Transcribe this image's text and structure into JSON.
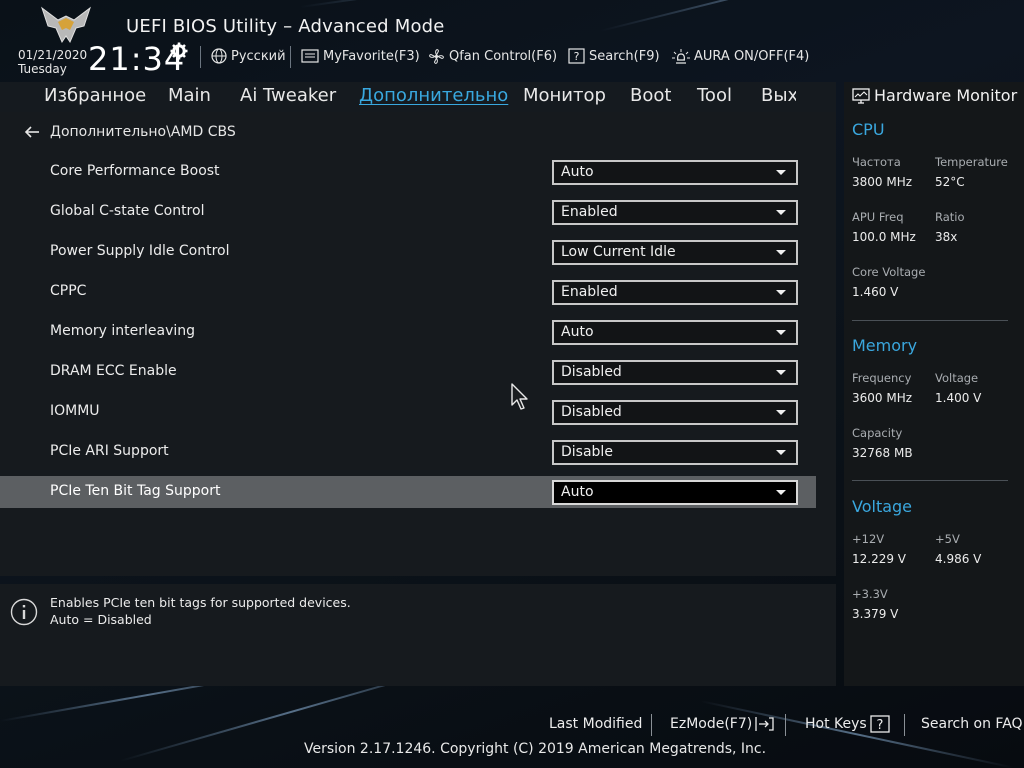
{
  "header": {
    "app_title": "UEFI BIOS Utility – Advanced Mode",
    "date": "01/21/2020",
    "day": "Tuesday",
    "time": "21:34",
    "toolbar": [
      {
        "label": "Русский",
        "icon": "globe-icon"
      },
      {
        "label": "MyFavorite(F3)",
        "icon": "favorite-icon"
      },
      {
        "label": "Qfan Control(F6)",
        "icon": "fan-icon"
      },
      {
        "label": "Search(F9)",
        "icon": "search-icon"
      },
      {
        "label": "AURA ON/OFF(F4)",
        "icon": "aura-icon"
      }
    ]
  },
  "nav": {
    "tabs": [
      {
        "label": "Избранное",
        "active": false
      },
      {
        "label": "Main",
        "active": false
      },
      {
        "label": "Ai Tweaker",
        "active": false
      },
      {
        "label": "Дополнительно",
        "active": true
      },
      {
        "label": "Монитор",
        "active": false
      },
      {
        "label": "Boot",
        "active": false
      },
      {
        "label": "Tool",
        "active": false
      },
      {
        "label": "Выход",
        "active": false
      }
    ]
  },
  "main": {
    "breadcrumb": "Дополнительно\\AMD CBS",
    "settings": [
      {
        "label": "Core Performance Boost",
        "value": "Auto"
      },
      {
        "label": "Global C-state Control",
        "value": "Enabled"
      },
      {
        "label": "Power Supply Idle Control",
        "value": "Low Current Idle"
      },
      {
        "label": "CPPC",
        "value": "Enabled"
      },
      {
        "label": "Memory interleaving",
        "value": "Auto"
      },
      {
        "label": "DRAM ECC Enable",
        "value": "Disabled"
      },
      {
        "label": "IOMMU",
        "value": "Disabled"
      },
      {
        "label": "PCIe ARI Support",
        "value": "Disable"
      },
      {
        "label": "PCIe Ten Bit Tag Support",
        "value": "Auto",
        "selected": true
      }
    ]
  },
  "help": {
    "line1": "Enables PCIe ten bit tags for supported devices.",
    "line2": "Auto = Disabled"
  },
  "hardware_monitor": {
    "title": "Hardware Monitor",
    "cpu": {
      "title": "CPU",
      "freq_label": "Частота",
      "freq_value": "3800 MHz",
      "temp_label": "Temperature",
      "temp_value": "52°C",
      "apu_label": "APU Freq",
      "apu_value": "100.0 MHz",
      "ratio_label": "Ratio",
      "ratio_value": "38x",
      "core_v_label": "Core Voltage",
      "core_v_value": "1.460 V"
    },
    "memory": {
      "title": "Memory",
      "freq_label": "Frequency",
      "freq_value": "3600 MHz",
      "volt_label": "Voltage",
      "volt_value": "1.400 V",
      "cap_label": "Capacity",
      "cap_value": "32768 MB"
    },
    "voltage": {
      "title": "Voltage",
      "v12_label": "+12V",
      "v12_value": "12.229 V",
      "v5_label": "+5V",
      "v5_value": "4.986 V",
      "v33_label": "+3.3V",
      "v33_value": "3.379 V"
    }
  },
  "footer": {
    "last_modified": "Last Modified",
    "ezmode": "EzMode(F7)",
    "hot_keys": "Hot Keys",
    "search_faq": "Search on FAQ",
    "copyright": "Version 2.17.1246. Copyright (C) 2019 American Megatrends, Inc."
  },
  "colors": {
    "accent": "#39a8df",
    "selected_row": "#5c5f62",
    "panel": "#161a1e"
  }
}
